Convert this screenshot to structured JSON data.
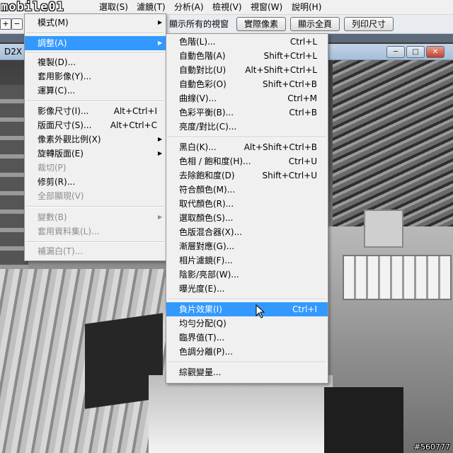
{
  "logo": "mobile01",
  "menubar": {
    "items": [
      "選取(S)",
      "濾鏡(T)",
      "分析(A)",
      "檢視(V)",
      "視窗(W)",
      "說明(H)"
    ]
  },
  "options": {
    "label": "顯示所有的視窗",
    "buttons": [
      "實際像素",
      "顯示全頁",
      "列印尺寸"
    ]
  },
  "document": {
    "title": "D2X"
  },
  "image_menu": {
    "items": [
      {
        "label": "模式(M)",
        "arrow": true
      },
      {
        "label": "調整(A)",
        "arrow": true,
        "highlighted": true
      },
      {
        "label": "複製(D)..."
      },
      {
        "label": "套用影像(Y)..."
      },
      {
        "label": "運算(C)..."
      },
      {
        "label": "影像尺寸(I)...",
        "shortcut": "Alt+Ctrl+I"
      },
      {
        "label": "版面尺寸(S)...",
        "shortcut": "Alt+Ctrl+C"
      },
      {
        "label": "像素外觀比例(X)",
        "arrow": true
      },
      {
        "label": "旋轉版面(E)",
        "arrow": true
      },
      {
        "label": "裁切(P)",
        "disabled": true
      },
      {
        "label": "修剪(R)..."
      },
      {
        "label": "全部顯現(V)",
        "disabled": true
      },
      {
        "label": "變數(B)",
        "arrow": true,
        "disabled": true
      },
      {
        "label": "套用資料集(L)...",
        "disabled": true
      },
      {
        "label": "補漏白(T)...",
        "disabled": true
      }
    ]
  },
  "adjust_menu": {
    "items": [
      {
        "label": "色階(L)...",
        "shortcut": "Ctrl+L"
      },
      {
        "label": "自動色階(A)",
        "shortcut": "Shift+Ctrl+L"
      },
      {
        "label": "自動對比(U)",
        "shortcut": "Alt+Shift+Ctrl+L"
      },
      {
        "label": "自動色彩(O)",
        "shortcut": "Shift+Ctrl+B"
      },
      {
        "label": "曲線(V)...",
        "shortcut": "Ctrl+M"
      },
      {
        "label": "色彩平衡(B)...",
        "shortcut": "Ctrl+B"
      },
      {
        "label": "亮度/對比(C)..."
      },
      {
        "label": "黑白(K)...",
        "shortcut": "Alt+Shift+Ctrl+B"
      },
      {
        "label": "色相 / 飽和度(H)...",
        "shortcut": "Ctrl+U"
      },
      {
        "label": "去除飽和度(D)",
        "shortcut": "Shift+Ctrl+U"
      },
      {
        "label": "符合顏色(M)..."
      },
      {
        "label": "取代顏色(R)..."
      },
      {
        "label": "選取顏色(S)..."
      },
      {
        "label": "色版混合器(X)..."
      },
      {
        "label": "漸層對應(G)..."
      },
      {
        "label": "相片濾鏡(F)..."
      },
      {
        "label": "陰影/亮部(W)..."
      },
      {
        "label": "曝光度(E)..."
      },
      {
        "label": "負片效果(I)",
        "shortcut": "Ctrl+I",
        "highlighted": true
      },
      {
        "label": "均勻分配(Q)"
      },
      {
        "label": "臨界值(T)..."
      },
      {
        "label": "色調分離(P)..."
      },
      {
        "label": "綜觀變量..."
      }
    ]
  },
  "watermark": "#560777",
  "colors": {
    "menu_bg": "#f0f0f0",
    "highlight": "#3399ff"
  }
}
